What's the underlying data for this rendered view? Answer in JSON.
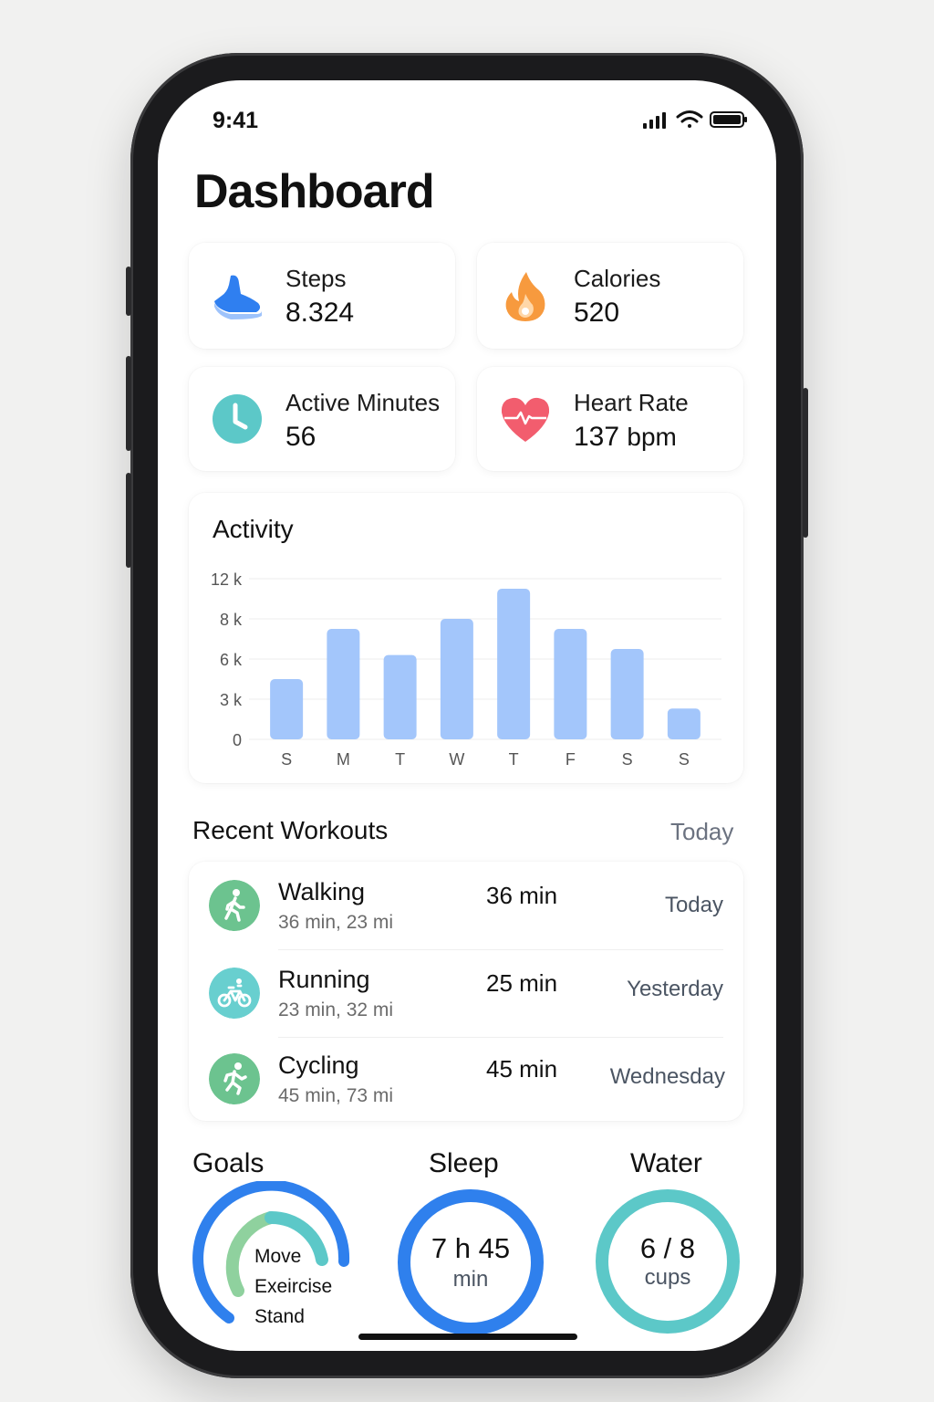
{
  "status": {
    "time": "9:41"
  },
  "page": {
    "title": "Dashboard"
  },
  "stats": {
    "steps": {
      "label": "Steps",
      "value": "8.324",
      "icon": "shoe-icon"
    },
    "calories": {
      "label": "Calories",
      "value": "520",
      "icon": "flame-icon"
    },
    "active": {
      "label": "Active Minutes",
      "value": "56",
      "icon": "clock-icon"
    },
    "heart": {
      "label": "Heart Rate",
      "value": "137",
      "unit": "bpm",
      "icon": "heart-pulse-icon"
    }
  },
  "chart_data": {
    "type": "bar",
    "title": "Activity",
    "categories": [
      "S",
      "M",
      "T",
      "W",
      "T",
      "F",
      "S",
      "S"
    ],
    "values": [
      4.5,
      7.5,
      6.2,
      8.0,
      11.0,
      7.5,
      6.5,
      2.3
    ],
    "y_ticks": [
      {
        "label": "12 k",
        "value": 12
      },
      {
        "label": "8 k",
        "value": 8
      },
      {
        "label": "6 k",
        "value": 6
      },
      {
        "label": "3 k",
        "value": 3
      },
      {
        "label": "0",
        "value": 0
      }
    ],
    "ylim": [
      0,
      12
    ],
    "grid": true,
    "bar_color": "#a3c6fb"
  },
  "workouts": {
    "title": "Recent Workouts",
    "link": "Today",
    "items": [
      {
        "name": "Walking",
        "sub": "36 min, 23 mi",
        "duration": "36 min",
        "day": "Today",
        "icon": "walking-icon",
        "color": "#6cc38f"
      },
      {
        "name": "Running",
        "sub": "23 min, 32 mi",
        "duration": "25 min",
        "day": "Yesterday",
        "icon": "bicycle-icon",
        "color": "#68cfcf"
      },
      {
        "name": "Cycling",
        "sub": "45 min, 73 mi",
        "duration": "45 min",
        "day": "Wednesday",
        "icon": "running-icon",
        "color": "#6cc38f"
      }
    ]
  },
  "goals": {
    "title": "Goals",
    "items": [
      "Move",
      "Exeircise",
      "Stand"
    ],
    "colors": {
      "move": "#2f80ed",
      "exercise": "#8fd19e",
      "stand": "#5cc8c8"
    }
  },
  "sleep": {
    "title": "Sleep",
    "value": "7 h 45",
    "unit": "min",
    "color": "#2f80ed"
  },
  "water": {
    "title": "Water",
    "value": "6 / 8",
    "unit": "cups",
    "color": "#5cc8c8"
  }
}
